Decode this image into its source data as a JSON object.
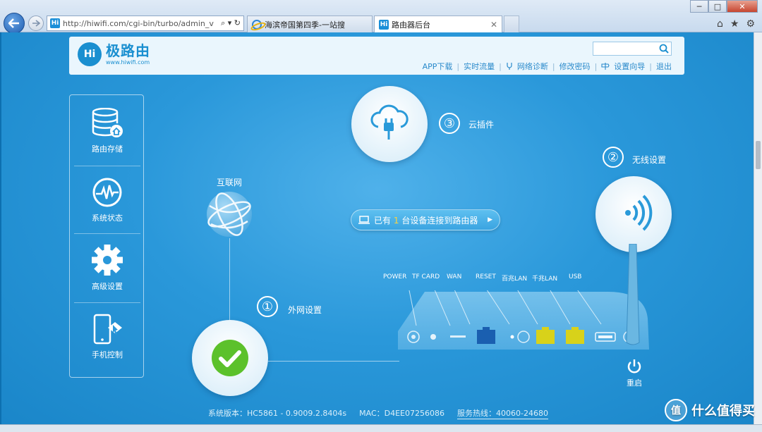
{
  "browser": {
    "url": "http://hiwifi.com/cgi-bin/turbo/admin_v",
    "url_tools": "⌕ ▾ ↻",
    "tabs": [
      {
        "label": "海滨帝国第四季-一站搜"
      },
      {
        "label": "路由器后台",
        "active": true
      }
    ],
    "window_buttons": [
      "─",
      "□",
      "✕"
    ]
  },
  "header": {
    "logo_text": "极路由",
    "logo_url": "www.hiwifi.com",
    "logo_mark": "Hi",
    "search": {
      "value": "",
      "placeholder": ""
    },
    "links": [
      {
        "label": "APP下载"
      },
      {
        "label": "实时流量"
      },
      {
        "label": "网络诊断"
      },
      {
        "label": "修改密码"
      },
      {
        "label": "设置向导"
      },
      {
        "label": "退出"
      }
    ]
  },
  "menu": [
    {
      "label": "路由存储",
      "icon": "storage-icon"
    },
    {
      "label": "系统状态",
      "icon": "status-icon"
    },
    {
      "label": "高级设置",
      "icon": "gear-icon"
    },
    {
      "label": "手机控制",
      "icon": "phone-control-icon"
    }
  ],
  "steps": {
    "cloud": {
      "num": "③",
      "label": "云插件"
    },
    "wireless": {
      "num": "②",
      "label": "无线设置"
    },
    "wan": {
      "num": "①",
      "label": "外网设置"
    }
  },
  "internet_label": "互联网",
  "devices_pill": {
    "prefix": "已有",
    "count": "1",
    "suffix": "台设备连接到路由器",
    "arrow": "▶"
  },
  "ports": [
    "POWER",
    "TF CARD",
    "WAN",
    "RESET",
    "百兆LAN",
    "千兆LAN",
    "USB"
  ],
  "reset_label": "重启",
  "footer": {
    "version": "系统版本：HC5861 - 0.9009.2.8404s",
    "mac": "MAC：D4EE07256086",
    "hotline": "服务热线：40060-24680"
  },
  "watermark": {
    "icon_text": "值",
    "text": "什么值得买"
  },
  "colors": {
    "accent": "#1a8fd0",
    "page_bg": "#2a98da",
    "check_green": "#5cc12b",
    "lan_yellow": "#d8d21a",
    "wan_blue": "#1a5fb0"
  }
}
